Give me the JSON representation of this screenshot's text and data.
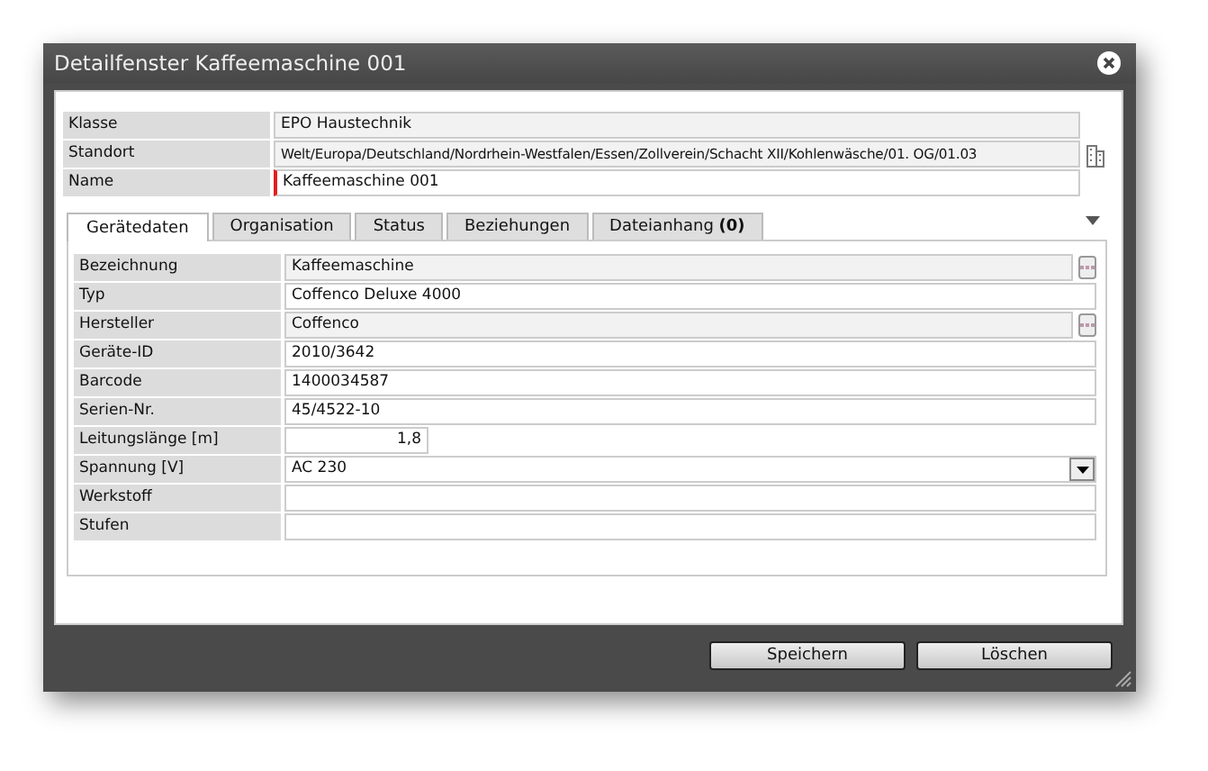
{
  "window": {
    "title": "Detailfenster Kaffeemaschine 001"
  },
  "header_fields": [
    {
      "label": "Klasse",
      "value": "EPO Haustechnik",
      "kind": "readonly",
      "required": false
    },
    {
      "label": "Standort",
      "value": "Welt/Europa/Deutschland/Nordrhein-Westfalen/Essen/Zollverein/Schacht XII/Kohlenwäsche/01. OG/01.03",
      "kind": "location",
      "required": false
    },
    {
      "label": "Name",
      "value": "Kaffeemaschine 001",
      "kind": "text",
      "required": true
    }
  ],
  "tabs": [
    {
      "label": "Gerätedaten",
      "selected": true
    },
    {
      "label": "Organisation",
      "selected": false
    },
    {
      "label": "Status",
      "selected": false
    },
    {
      "label": "Beziehungen",
      "selected": false
    },
    {
      "label": "Dateianhang **(0)**",
      "selected": false
    }
  ],
  "fields": [
    {
      "label": "Bezeichnung",
      "value": "Kaffeemaschine",
      "kind": "lookup"
    },
    {
      "label": "Typ",
      "value": "Coffenco Deluxe 4000",
      "kind": "text"
    },
    {
      "label": "Hersteller",
      "value": "Coffenco",
      "kind": "lookup"
    },
    {
      "label": "Geräte-ID",
      "value": "2010/3642",
      "kind": "text"
    },
    {
      "label": "Barcode",
      "value": "1400034587",
      "kind": "text"
    },
    {
      "label": "Serien-Nr.",
      "value": "45/4522-10",
      "kind": "text"
    },
    {
      "label": "Leitungslänge [m]",
      "value": "1,8",
      "kind": "number"
    },
    {
      "label": "Spannung [V]",
      "value": "AC 230",
      "kind": "select"
    },
    {
      "label": "Werkstoff",
      "kind": "text"
    },
    {
      "label": "Stufen",
      "kind": "text"
    }
  ],
  "buttons": [
    "Speichern",
    "Löschen"
  ]
}
